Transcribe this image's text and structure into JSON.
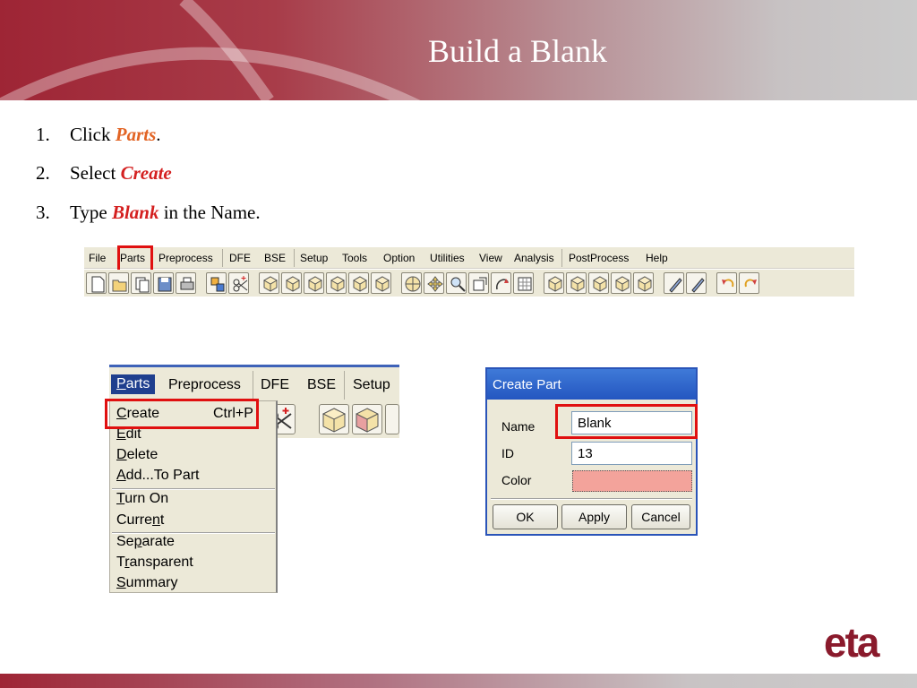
{
  "slide": {
    "title": "Build a Blank",
    "logo_text": "eta",
    "accent_color": "#9e2535"
  },
  "steps": [
    {
      "num": "1.",
      "pre": "Click ",
      "keyword": "Parts",
      "post": "."
    },
    {
      "num": "2.",
      "pre": "Select ",
      "keyword": "Create",
      "post": ""
    },
    {
      "num": "3.",
      "pre": "Type ",
      "keyword": "Blank",
      "post": " in the Name."
    }
  ],
  "menubar": {
    "items": [
      "File",
      "Parts",
      "Preprocess",
      "DFE",
      "BSE",
      "Setup",
      "Tools",
      "Option",
      "Utilities",
      "View",
      "Analysis",
      "PostProcess",
      "Help"
    ]
  },
  "toolbar": {
    "icons": [
      "new-file-icon",
      "open-folder-icon",
      "copy-icon",
      "save-icon",
      "print-icon",
      "move-icon",
      "scissors-icon",
      "cube-view-icon",
      "cube-view-icon",
      "cube-view-icon",
      "cube-view-icon",
      "cube-view-icon",
      "cube-view-icon",
      "sphere-icon",
      "pan-icon",
      "zoom-icon",
      "zoom-box-icon",
      "rotate-icon",
      "grid-icon",
      "cube-view-icon",
      "cube-view-icon",
      "cube-view-icon",
      "cube-view-icon",
      "cube-view-icon",
      "pen-icon",
      "pen-icon",
      "undo-icon",
      "redo-icon"
    ]
  },
  "zoom_menubar": {
    "items": [
      "Parts",
      "Preprocess",
      "DFE",
      "BSE",
      "Setup"
    ]
  },
  "parts_menu": {
    "items": [
      {
        "label": "Create",
        "shortcut": "Ctrl+P"
      },
      {
        "label": "Edit"
      },
      {
        "label": "Delete"
      },
      {
        "label": "Add...To Part"
      },
      {
        "label": "Turn On"
      },
      {
        "label": "Current"
      },
      {
        "label": "Separate"
      },
      {
        "label": "Transparent"
      },
      {
        "label": "Summary"
      }
    ]
  },
  "dialog": {
    "title": "Create Part",
    "name_label": "Name",
    "name_value": "Blank",
    "id_label": "ID",
    "id_value": "13",
    "color_label": "Color",
    "color_value": "#f3a39b",
    "ok_label": "OK",
    "apply_label": "Apply",
    "cancel_label": "Cancel"
  }
}
